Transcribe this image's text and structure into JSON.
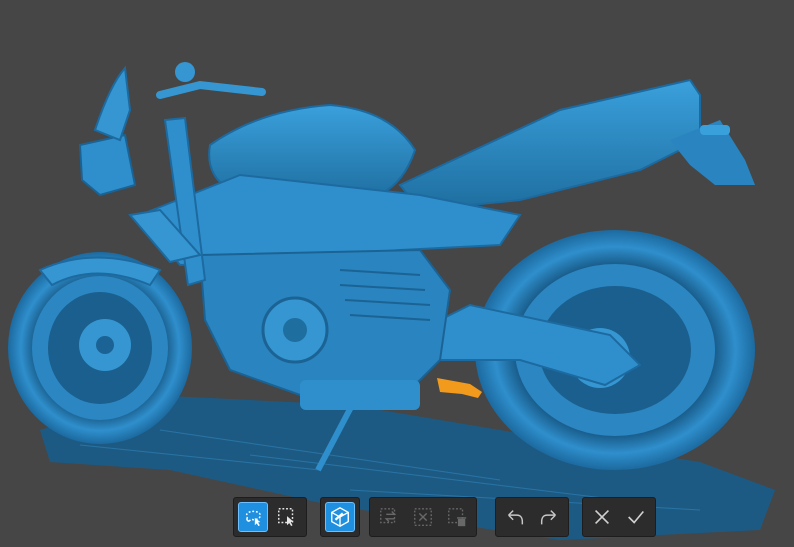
{
  "app": {
    "background_color": "#464646",
    "model_color": "#2f8fcc",
    "highlight_color": "#f29a1c",
    "accent_color": "#1f8fe0"
  },
  "toolbar": {
    "groups": [
      {
        "items": [
          {
            "name": "lasso-select-button",
            "icon": "lasso-select-icon",
            "state": "active"
          },
          {
            "name": "rect-select-button",
            "icon": "rect-select-icon",
            "state": "normal"
          }
        ]
      },
      {
        "items": [
          {
            "name": "view-cube-button",
            "icon": "cube-icon",
            "state": "active"
          }
        ]
      },
      {
        "items": [
          {
            "name": "invert-selection-button",
            "icon": "invert-selection-icon",
            "state": "disabled"
          },
          {
            "name": "clear-selection-button",
            "icon": "clear-selection-icon",
            "state": "disabled"
          },
          {
            "name": "delete-selection-button",
            "icon": "delete-selection-icon",
            "state": "disabled"
          }
        ]
      },
      {
        "items": [
          {
            "name": "undo-button",
            "icon": "undo-icon",
            "state": "normal"
          },
          {
            "name": "redo-button",
            "icon": "redo-icon",
            "state": "normal"
          }
        ]
      },
      {
        "items": [
          {
            "name": "cancel-button",
            "icon": "close-icon",
            "state": "normal"
          },
          {
            "name": "confirm-button",
            "icon": "check-icon",
            "state": "normal"
          }
        ]
      }
    ]
  }
}
